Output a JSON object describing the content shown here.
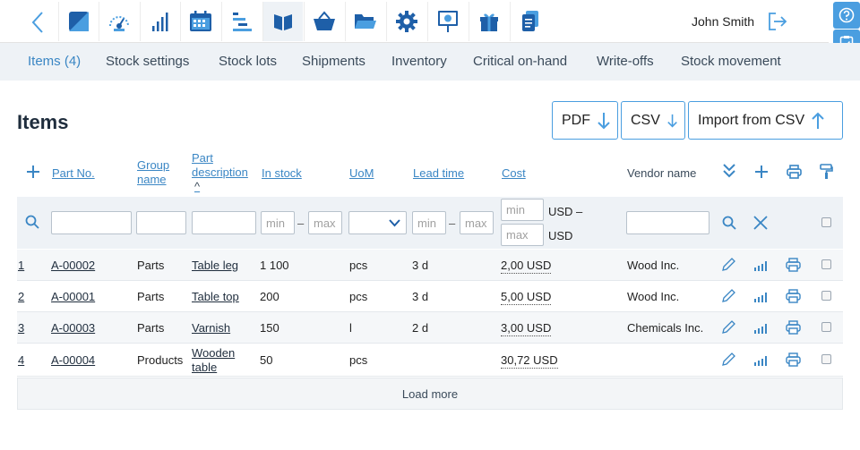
{
  "toolbar": {
    "icons": [
      "back-icon",
      "dashboard-icon",
      "speedometer-icon",
      "bar-chart-icon",
      "calendar-icon",
      "gantt-icon",
      "book-icon",
      "basket-icon",
      "folder-icon",
      "gear-icon",
      "presentation-icon",
      "gift-icon",
      "documents-icon"
    ],
    "active_icon": "book-icon",
    "user_name": "John Smith"
  },
  "tabs": [
    {
      "label": "Items (4)",
      "active": true
    },
    {
      "label": "Stock settings"
    },
    {
      "label": "Stock lots"
    },
    {
      "label": "Shipments"
    },
    {
      "label": "Inventory"
    },
    {
      "label": "Critical on-hand"
    },
    {
      "label": "Write-offs"
    },
    {
      "label": "Stock movement"
    }
  ],
  "page": {
    "title": "Items",
    "pdf_label": "PDF",
    "csv_label": "CSV",
    "import_label": "Import from CSV"
  },
  "columns": {
    "part_no": "Part No.",
    "group_name_1": "Group",
    "group_name_2": "name",
    "desc_1": "Part",
    "desc_2": "description",
    "sort_mark": "^",
    "in_stock": "In stock",
    "uom": "UoM",
    "lead_time": "Lead time",
    "cost": "Cost",
    "vendor": "Vendor name"
  },
  "filters": {
    "min_placeholder": "min",
    "max_placeholder": "max",
    "dash": "–",
    "usd_dash": "USD –",
    "usd": "USD"
  },
  "rows": [
    {
      "num": "1",
      "part_no": "A-00002",
      "group": "Parts",
      "desc": "Table leg",
      "in_stock": "1 100",
      "uom": "pcs",
      "lead": "3 d",
      "cost": "2,00 USD",
      "vendor": "Wood Inc."
    },
    {
      "num": "2",
      "part_no": "A-00001",
      "group": "Parts",
      "desc": "Table top",
      "in_stock": "200",
      "uom": "pcs",
      "lead": "3 d",
      "cost": "5,00 USD",
      "vendor": "Wood Inc."
    },
    {
      "num": "3",
      "part_no": "A-00003",
      "group": "Parts",
      "desc": "Varnish",
      "in_stock": "150",
      "uom": "l",
      "lead": "2 d",
      "cost": "3,00 USD",
      "vendor": "Chemicals Inc."
    },
    {
      "num": "4",
      "part_no": "A-00004",
      "group": "Products",
      "desc_1": "Wooden",
      "desc_2": "table",
      "in_stock": "50",
      "uom": "pcs",
      "lead": "",
      "cost": "30,72 USD",
      "vendor": ""
    }
  ],
  "load_more": "Load more",
  "colors": {
    "accent": "#4a9ee0",
    "link": "#3a86c4",
    "toolbar_blue": "#1e5fa8",
    "band": "#eef2f6"
  }
}
